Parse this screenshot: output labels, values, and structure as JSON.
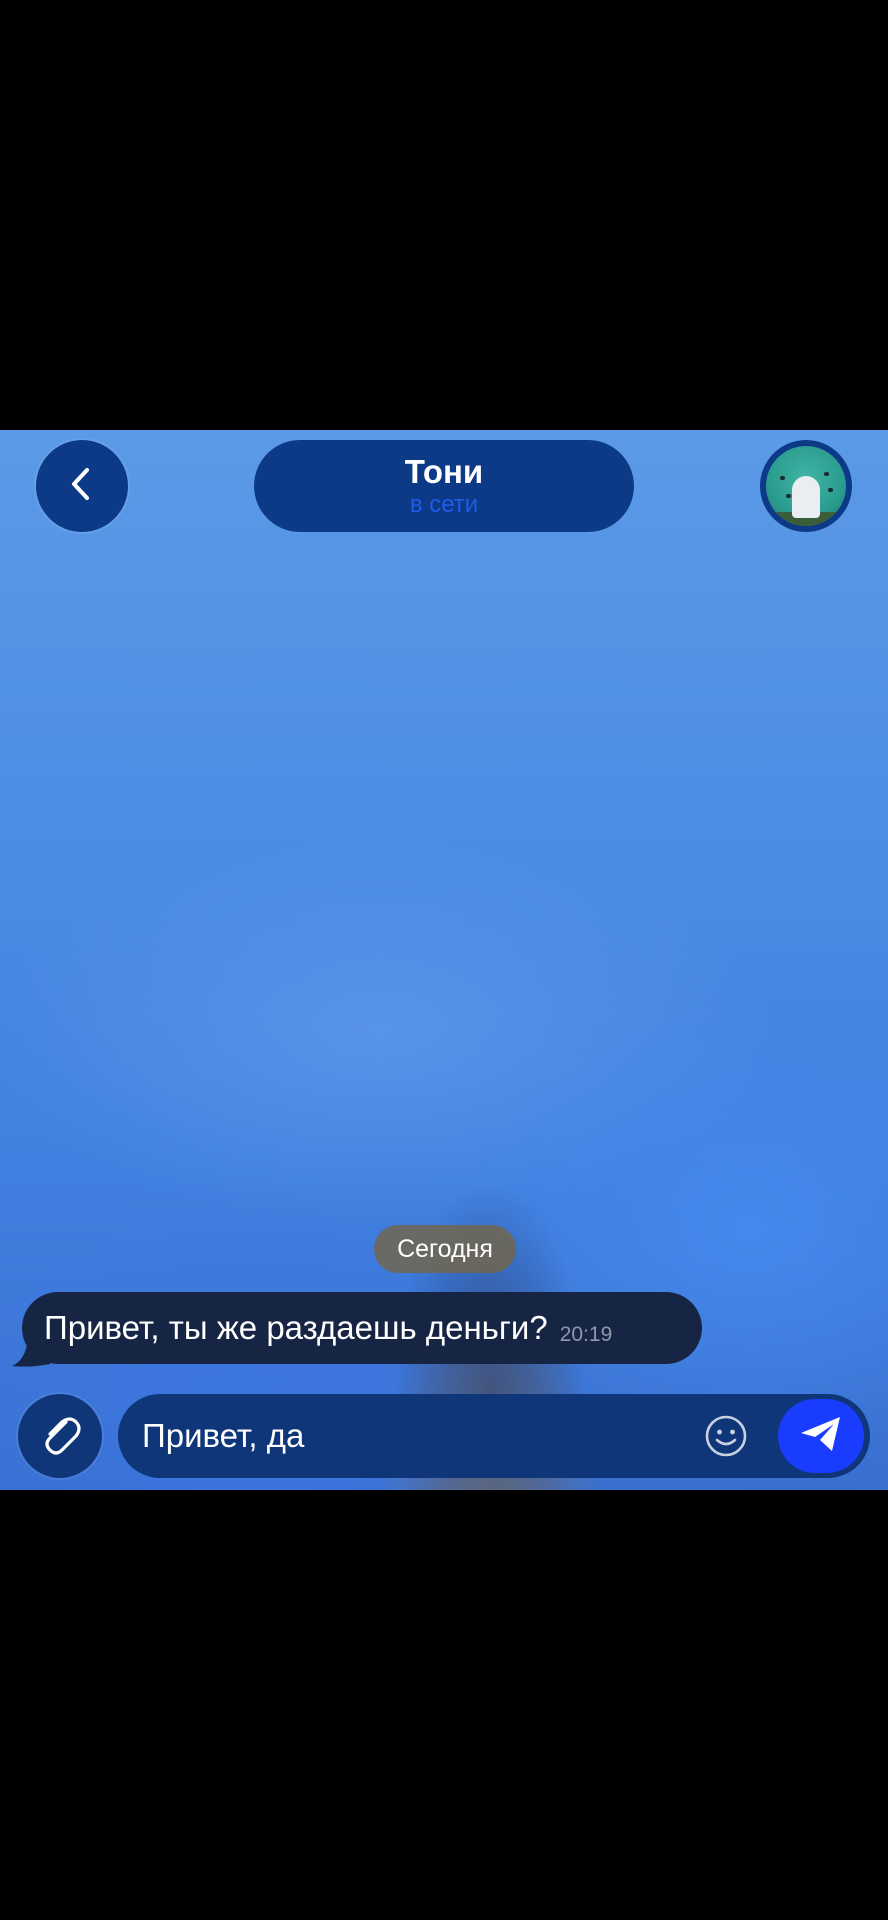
{
  "header": {
    "back_icon": "chevron-left-icon",
    "title": "Тони",
    "status": "в сети",
    "avatar_description": "avatar-image"
  },
  "messages": {
    "date_divider": "Сегодня",
    "items": [
      {
        "direction": "incoming",
        "text": "Привет, ты же раздаешь деньги?",
        "time": "20:19"
      }
    ]
  },
  "composer": {
    "attach_icon": "paperclip-icon",
    "value": "Привет, да",
    "emoji_icon": "smiley-icon",
    "send_icon": "paper-plane-icon"
  },
  "colors": {
    "header_pill": "#0d3a86",
    "status_text": "#1f5be8",
    "bubble_incoming": "#172544",
    "send_button": "#1a3cff"
  }
}
